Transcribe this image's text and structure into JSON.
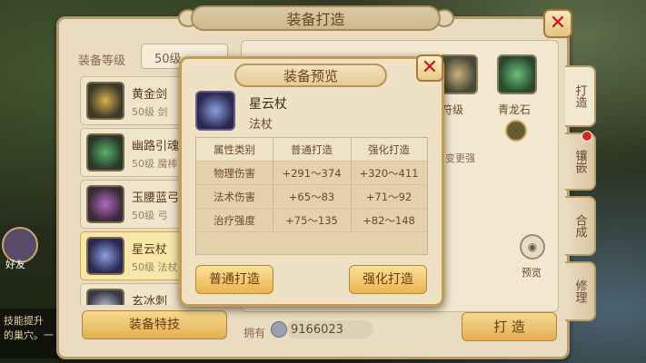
{
  "main_panel": {
    "title": "装备打造",
    "level_label": "装备等级",
    "level_value": "50级",
    "equipment_list": [
      {
        "name": "黄金剑",
        "level": "50级",
        "category": "剑"
      },
      {
        "name": "幽路引魂",
        "level": "50级",
        "category": "魔棒"
      },
      {
        "name": "玉腰蓝弓",
        "level": "50级",
        "category": "弓"
      },
      {
        "name": "星云杖",
        "level": "50级",
        "category": "法杖"
      },
      {
        "name": "玄冰刺",
        "level": "",
        "category": ""
      }
    ],
    "feature_button": "装备特技",
    "materials": [
      {
        "name": "符级",
        "icon": "scroll-icon"
      },
      {
        "name": "青龙石",
        "icon": "jade-stone-icon"
      }
    ],
    "hint_text": "变更强",
    "preview_label": "预览",
    "owned_label": "拥有",
    "owned_value": "9166023",
    "forge_button": "打 造"
  },
  "side_tabs": [
    {
      "label": "打造",
      "active": true
    },
    {
      "label": "镶嵌",
      "active": false,
      "badge": true
    },
    {
      "label": "合成",
      "active": false
    },
    {
      "label": "修理",
      "active": false
    }
  ],
  "hud": {
    "chat_lines": [
      "技能提升",
      "的巢穴。一"
    ],
    "avatar_label": "好友"
  },
  "dialog": {
    "title": "装备预览",
    "item_name": "星云杖",
    "item_type": "法杖",
    "table": {
      "headers": [
        "属性类别",
        "普通打造",
        "强化打造"
      ],
      "rows": [
        [
          "物理伤害",
          "+291～374",
          "+320～411"
        ],
        [
          "法术伤害",
          "+65～83",
          "+71～92"
        ],
        [
          "治疗强度",
          "+75～135",
          "+82～148"
        ]
      ]
    },
    "normal_button": "普通打造",
    "enhanced_button": "强化打造"
  },
  "colors": {
    "accent_gold": "#e2b054",
    "close_red": "#c4161c",
    "badge_red": "#d8261e"
  }
}
